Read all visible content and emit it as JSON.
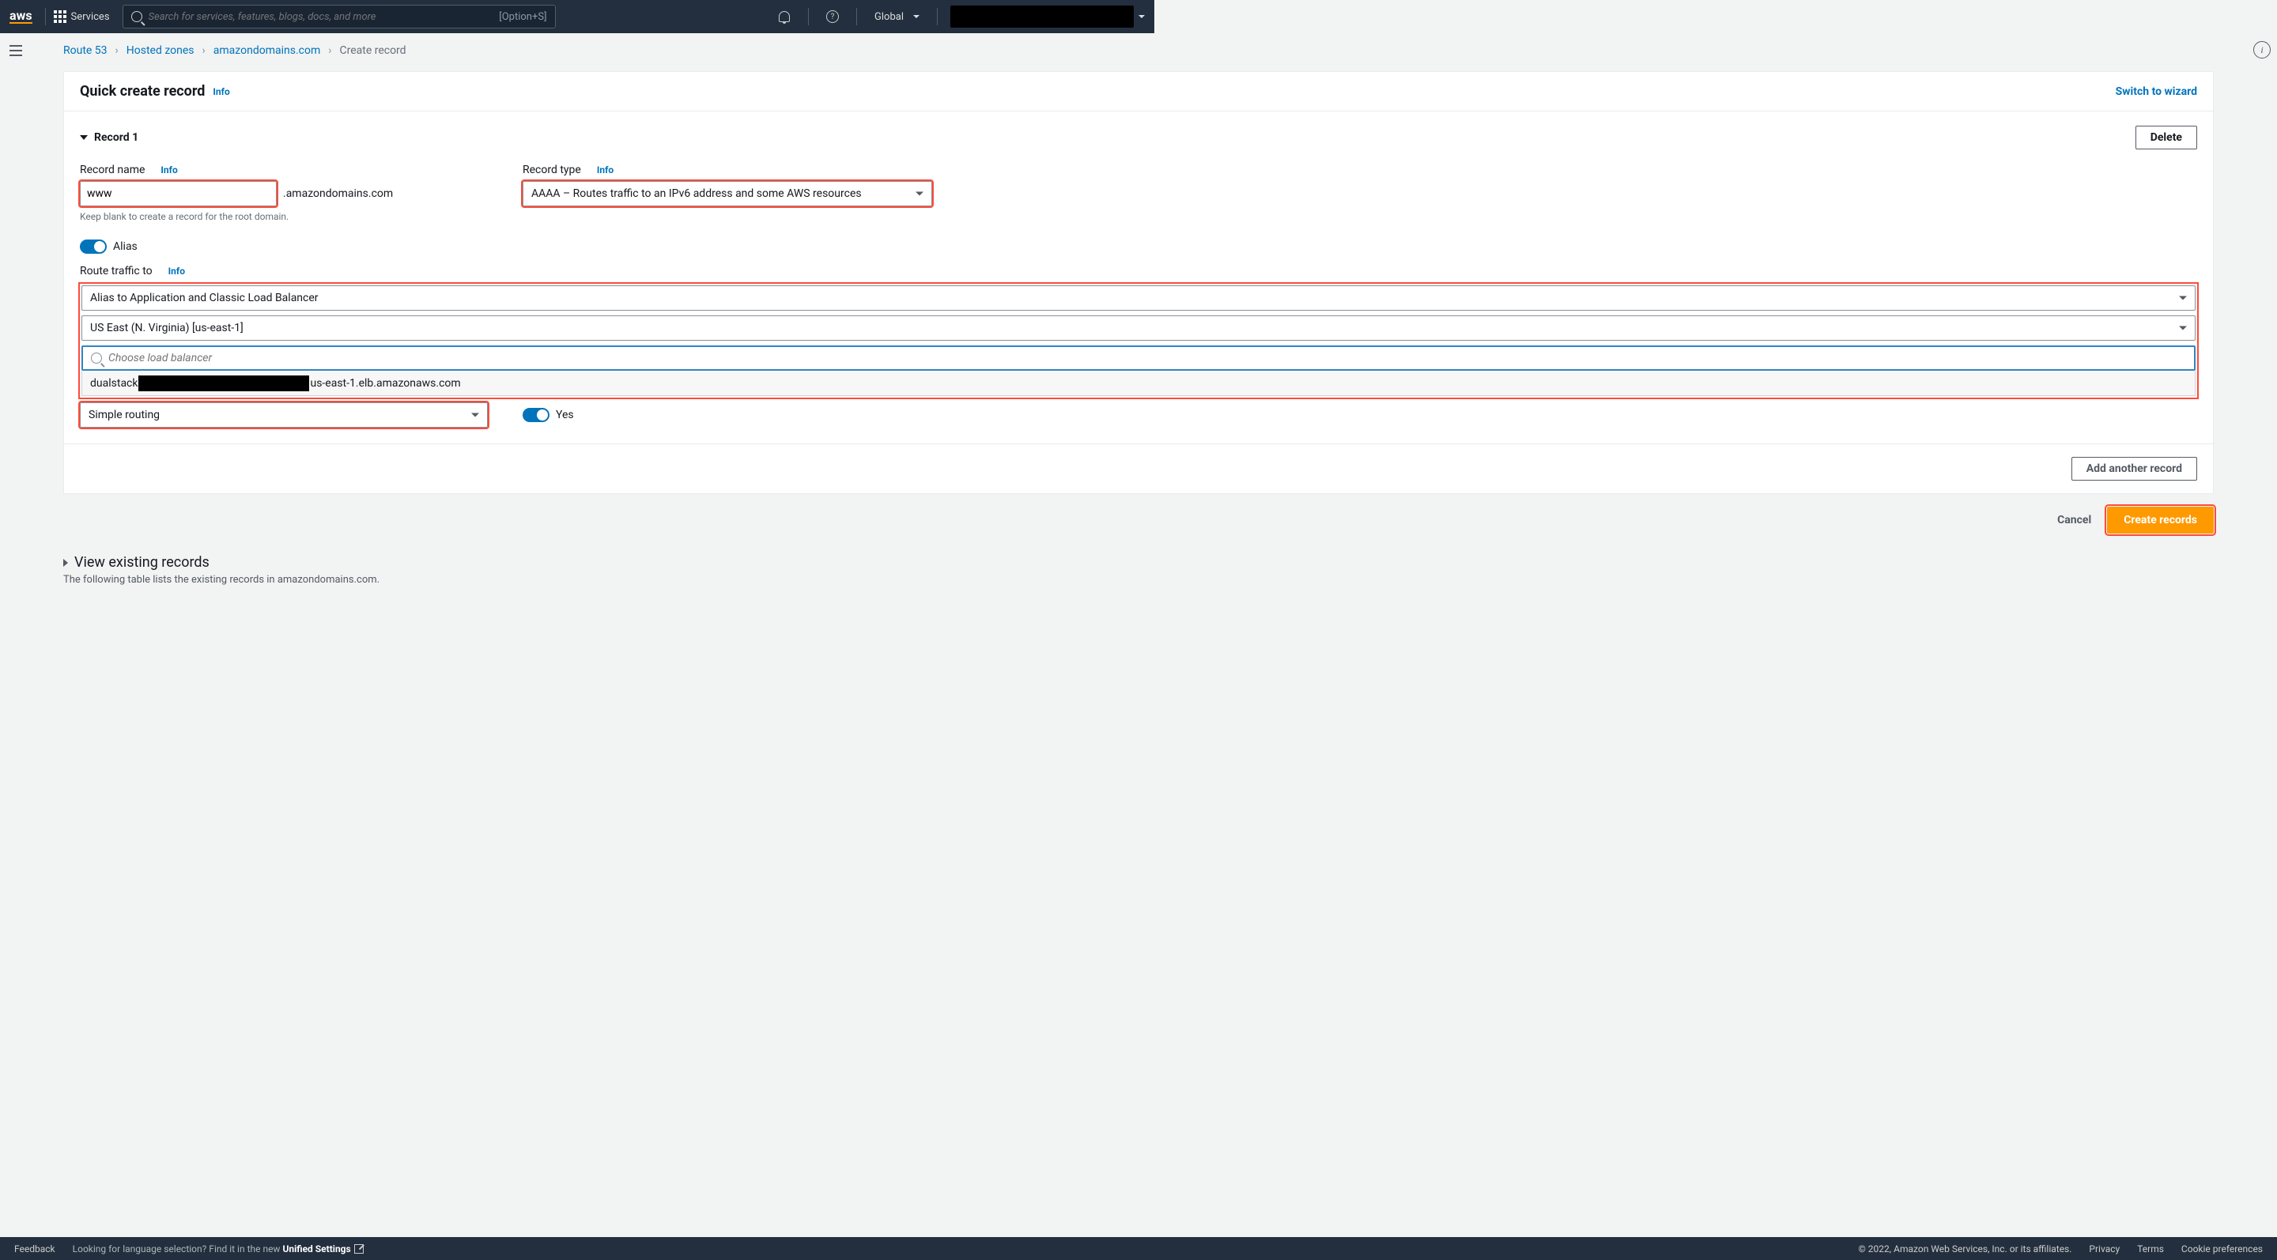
{
  "topnav": {
    "services": "Services",
    "search_placeholder": "Search for services, features, blogs, docs, and more",
    "search_shortcut": "[Option+S]",
    "region": "Global"
  },
  "breadcrumb": {
    "items": [
      "Route 53",
      "Hosted zones",
      "amazondomains.com"
    ],
    "current": "Create record"
  },
  "header": {
    "title": "Quick create record",
    "info": "Info",
    "switch": "Switch to wizard"
  },
  "record": {
    "heading": "Record 1",
    "delete": "Delete",
    "name_label": "Record name",
    "name_info": "Info",
    "name_value": "www",
    "name_suffix": ".amazondomains.com",
    "name_hint": "Keep blank to create a record for the root domain.",
    "type_label": "Record type",
    "type_info": "Info",
    "type_value": "AAAA – Routes traffic to an IPv6 address and some AWS resources",
    "alias_label": "Alias",
    "route_label": "Route traffic to",
    "route_info": "Info",
    "alias_target": "Alias to Application and Classic Load Balancer",
    "region_value": "US East (N. Virginia) [us-east-1]",
    "lb_placeholder": "Choose load balancer",
    "lb_option_prefix": "dualstack",
    "lb_option_suffix": "us-east-1.elb.amazonaws.com",
    "routing_value": "Simple routing",
    "yes_label": "Yes",
    "add_another": "Add another record"
  },
  "actions": {
    "cancel": "Cancel",
    "create": "Create records"
  },
  "existing": {
    "title": "View existing records",
    "desc": "The following table lists the existing records in amazondomains.com."
  },
  "footer": {
    "feedback": "Feedback",
    "lang_prompt": "Looking for language selection? Find it in the new ",
    "unified": "Unified Settings",
    "copyright": "© 2022, Amazon Web Services, Inc. or its affiliates.",
    "privacy": "Privacy",
    "terms": "Terms",
    "cookie": "Cookie preferences"
  }
}
